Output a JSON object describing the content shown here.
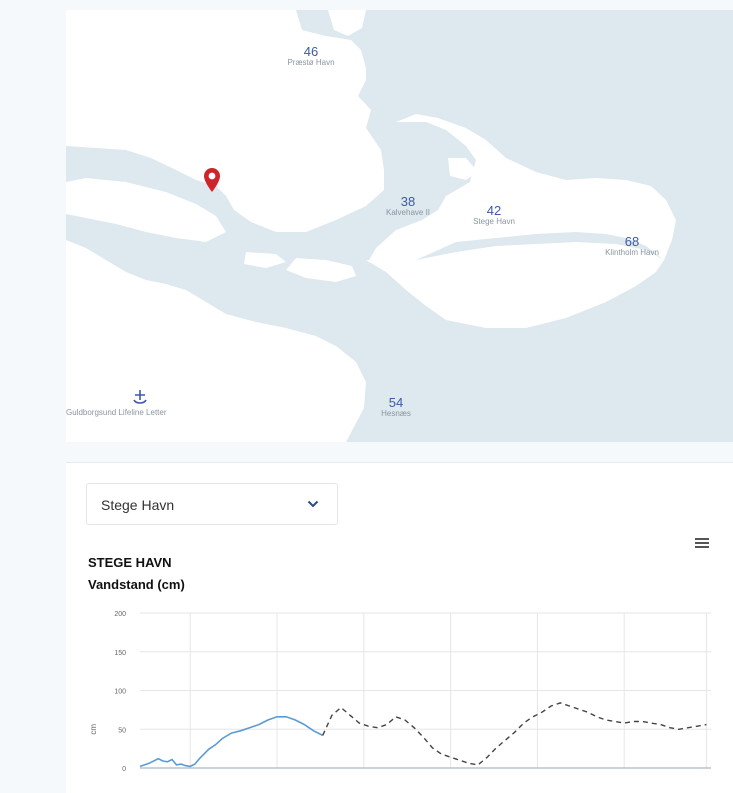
{
  "map": {
    "stations": [
      {
        "id": "praesto",
        "value": "46",
        "name": "Præstø Havn"
      },
      {
        "id": "kalvehave",
        "value": "38",
        "name": "Kalvehave II"
      },
      {
        "id": "stege",
        "value": "42",
        "name": "Stege Havn"
      },
      {
        "id": "klintholm",
        "value": "68",
        "name": "Klintholm Havn"
      },
      {
        "id": "hesnaes",
        "value": "54",
        "name": "Hesnæs"
      }
    ],
    "ship_label": "Guldborgsund Lifeline Letter",
    "pin_color": "#d0242b"
  },
  "selector": {
    "selected": "Stege Havn"
  },
  "chart_data": {
    "type": "line",
    "title": "STEGE HAVN",
    "subtitle": "Vandstand (cm)",
    "ylabel": "cm",
    "ylim": [
      0,
      200
    ],
    "yticks": [
      "200",
      "150",
      "100",
      "50",
      "0"
    ],
    "grid": true,
    "series": [
      {
        "style": "solid",
        "color": "#5b9bd5",
        "points": [
          [
            0,
            2
          ],
          [
            4,
            6
          ],
          [
            8,
            12
          ],
          [
            10,
            9
          ],
          [
            12,
            8
          ],
          [
            14,
            11
          ],
          [
            16,
            4
          ],
          [
            18,
            5
          ],
          [
            20,
            3
          ],
          [
            22,
            2
          ],
          [
            24,
            5
          ],
          [
            26,
            12
          ],
          [
            28,
            18
          ],
          [
            30,
            24
          ],
          [
            33,
            30
          ],
          [
            36,
            38
          ],
          [
            40,
            45
          ],
          [
            44,
            48
          ],
          [
            48,
            52
          ],
          [
            52,
            56
          ],
          [
            56,
            62
          ],
          [
            60,
            66
          ],
          [
            64,
            66
          ],
          [
            68,
            62
          ],
          [
            72,
            56
          ],
          [
            76,
            48
          ],
          [
            80,
            42
          ]
        ]
      },
      {
        "style": "dashed",
        "color": "#444444",
        "points": [
          [
            80,
            42
          ],
          [
            84,
            68
          ],
          [
            88,
            78
          ],
          [
            92,
            68
          ],
          [
            96,
            58
          ],
          [
            100,
            54
          ],
          [
            104,
            52
          ],
          [
            108,
            56
          ],
          [
            112,
            66
          ],
          [
            116,
            62
          ],
          [
            120,
            52
          ],
          [
            124,
            40
          ],
          [
            128,
            26
          ],
          [
            132,
            18
          ],
          [
            136,
            14
          ],
          [
            140,
            10
          ],
          [
            144,
            6
          ],
          [
            148,
            4
          ],
          [
            152,
            14
          ],
          [
            156,
            26
          ],
          [
            160,
            36
          ],
          [
            164,
            46
          ],
          [
            168,
            58
          ],
          [
            172,
            66
          ],
          [
            176,
            72
          ],
          [
            180,
            80
          ],
          [
            184,
            84
          ],
          [
            188,
            80
          ],
          [
            192,
            76
          ],
          [
            196,
            72
          ],
          [
            200,
            66
          ],
          [
            204,
            62
          ],
          [
            208,
            60
          ],
          [
            212,
            58
          ],
          [
            216,
            60
          ],
          [
            220,
            60
          ],
          [
            224,
            58
          ],
          [
            228,
            56
          ],
          [
            232,
            52
          ],
          [
            236,
            50
          ],
          [
            240,
            52
          ],
          [
            244,
            54
          ],
          [
            248,
            56
          ]
        ]
      }
    ],
    "xlim": [
      0,
      250
    ],
    "vgrid": [
      22,
      60,
      98,
      136,
      174,
      212,
      248
    ]
  }
}
